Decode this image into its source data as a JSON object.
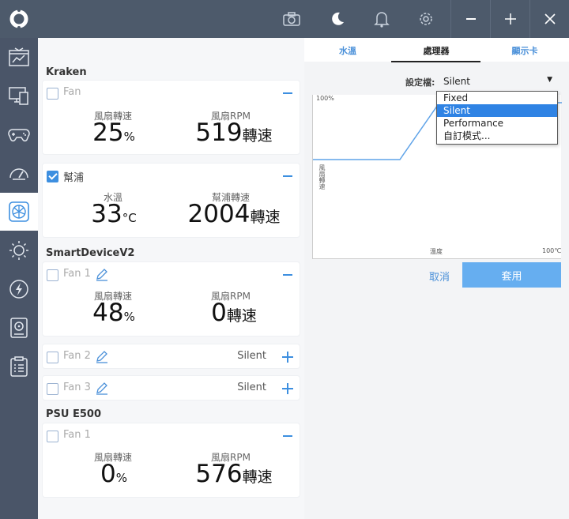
{
  "topbar": {
    "icons": [
      "camera-icon",
      "moon-icon",
      "bell-icon",
      "gear-icon"
    ],
    "window": [
      "minimize-icon",
      "maximize-icon",
      "close-icon"
    ]
  },
  "sidebar": {
    "items": [
      "dashboard-icon",
      "monitor-icon",
      "gamepad-icon",
      "gauge-icon",
      "fan-icon",
      "sun-icon",
      "power-icon",
      "storage-icon",
      "clipboard-icon"
    ],
    "active_index": 4
  },
  "kraken": {
    "title": "Kraken",
    "fan": {
      "name": "Fan",
      "speed_label": "風扇轉速",
      "speed_value": "25",
      "speed_unit": "%",
      "rpm_label": "風扇RPM",
      "rpm_value": "519",
      "rpm_unit": "轉速"
    },
    "pump": {
      "name": "幫浦",
      "temp_label": "水溫",
      "temp_value": "33",
      "temp_unit": "°C",
      "speed_label": "幫浦轉速",
      "speed_value": "2004",
      "speed_unit": "轉速"
    }
  },
  "smartdevice": {
    "title": "SmartDeviceV2",
    "fan1": {
      "name": "Fan 1",
      "speed_label": "風扇轉速",
      "speed_value": "48",
      "speed_unit": "%",
      "rpm_label": "風扇RPM",
      "rpm_value": "0",
      "rpm_unit": "轉速"
    },
    "fan2": {
      "name": "Fan 2",
      "mode": "Silent"
    },
    "fan3": {
      "name": "Fan 3",
      "mode": "Silent"
    }
  },
  "psu": {
    "title": "PSU E500",
    "fan1": {
      "name": "Fan 1",
      "speed_label": "風扇轉速",
      "speed_value": "0",
      "speed_unit": "%",
      "rpm_label": "風扇RPM",
      "rpm_value": "576",
      "rpm_unit": "轉速"
    }
  },
  "right": {
    "tabs": [
      "水溫",
      "處理器",
      "顯示卡"
    ],
    "active_tab": 1,
    "profile_label": "設定檔:",
    "profile_value": "Silent",
    "dropdown_options": [
      "Fixed",
      "Silent",
      "Performance",
      "自訂模式..."
    ],
    "dropdown_selected": 1,
    "chart_y_max": "100%",
    "chart_y_label": "風扇轉速",
    "chart_x_label": "溫度",
    "chart_x_max": "100℃",
    "cancel_label": "取消",
    "apply_label": "套用"
  },
  "colors": {
    "accent": "#3d8fe0",
    "sidebar": "#4a5568",
    "apply": "#66aef0"
  }
}
